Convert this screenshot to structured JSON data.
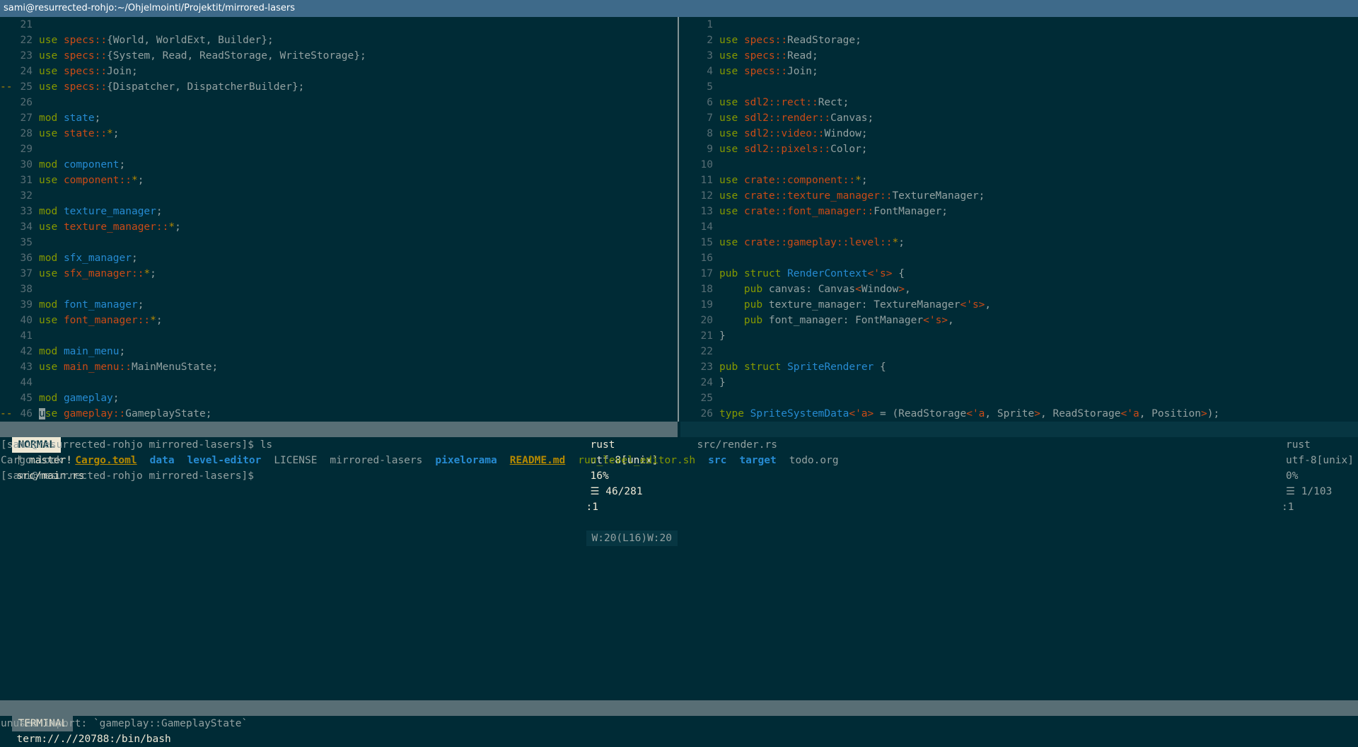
{
  "window": {
    "title": "sami@resurrected-rohjo:~/Ohjelmointi/Projektit/mirrored-lasers"
  },
  "left_pane": {
    "lines": [
      {
        "sign": "",
        "num": "21",
        "tokens": []
      },
      {
        "sign": "",
        "num": "22",
        "tokens": [
          {
            "t": "use",
            "c": "kw"
          },
          {
            "t": " "
          },
          {
            "t": "specs::",
            "c": "path"
          },
          {
            "t": "{World, WorldExt, Builder};"
          }
        ]
      },
      {
        "sign": "",
        "num": "23",
        "tokens": [
          {
            "t": "use",
            "c": "kw"
          },
          {
            "t": " "
          },
          {
            "t": "specs::",
            "c": "path"
          },
          {
            "t": "{System, Read, ReadStorage, WriteStorage};"
          }
        ]
      },
      {
        "sign": "",
        "num": "24",
        "tokens": [
          {
            "t": "use",
            "c": "kw"
          },
          {
            "t": " "
          },
          {
            "t": "specs::",
            "c": "path"
          },
          {
            "t": "Join;"
          }
        ]
      },
      {
        "sign": "--",
        "num": "25",
        "tokens": [
          {
            "t": "use",
            "c": "kw"
          },
          {
            "t": " "
          },
          {
            "t": "specs::",
            "c": "path"
          },
          {
            "t": "{Dispatcher, DispatcherBuilder};"
          }
        ]
      },
      {
        "sign": "",
        "num": "26",
        "tokens": []
      },
      {
        "sign": "",
        "num": "27",
        "tokens": [
          {
            "t": "mod",
            "c": "kw"
          },
          {
            "t": " "
          },
          {
            "t": "state",
            "c": "type"
          },
          {
            "t": ";"
          }
        ]
      },
      {
        "sign": "",
        "num": "28",
        "tokens": [
          {
            "t": "use",
            "c": "kw"
          },
          {
            "t": " "
          },
          {
            "t": "state::",
            "c": "path"
          },
          {
            "t": "*",
            "c": "op"
          },
          {
            "t": ";"
          }
        ]
      },
      {
        "sign": "",
        "num": "29",
        "tokens": []
      },
      {
        "sign": "",
        "num": "30",
        "tokens": [
          {
            "t": "mod",
            "c": "kw"
          },
          {
            "t": " "
          },
          {
            "t": "component",
            "c": "type"
          },
          {
            "t": ";"
          }
        ]
      },
      {
        "sign": "",
        "num": "31",
        "tokens": [
          {
            "t": "use",
            "c": "kw"
          },
          {
            "t": " "
          },
          {
            "t": "component::",
            "c": "path"
          },
          {
            "t": "*",
            "c": "op"
          },
          {
            "t": ";"
          }
        ]
      },
      {
        "sign": "",
        "num": "32",
        "tokens": []
      },
      {
        "sign": "",
        "num": "33",
        "tokens": [
          {
            "t": "mod",
            "c": "kw"
          },
          {
            "t": " "
          },
          {
            "t": "texture_manager",
            "c": "type"
          },
          {
            "t": ";"
          }
        ]
      },
      {
        "sign": "",
        "num": "34",
        "tokens": [
          {
            "t": "use",
            "c": "kw"
          },
          {
            "t": " "
          },
          {
            "t": "texture_manager::",
            "c": "path"
          },
          {
            "t": "*",
            "c": "op"
          },
          {
            "t": ";"
          }
        ]
      },
      {
        "sign": "",
        "num": "35",
        "tokens": []
      },
      {
        "sign": "",
        "num": "36",
        "tokens": [
          {
            "t": "mod",
            "c": "kw"
          },
          {
            "t": " "
          },
          {
            "t": "sfx_manager",
            "c": "type"
          },
          {
            "t": ";"
          }
        ]
      },
      {
        "sign": "",
        "num": "37",
        "tokens": [
          {
            "t": "use",
            "c": "kw"
          },
          {
            "t": " "
          },
          {
            "t": "sfx_manager::",
            "c": "path"
          },
          {
            "t": "*",
            "c": "op"
          },
          {
            "t": ";"
          }
        ]
      },
      {
        "sign": "",
        "num": "38",
        "tokens": []
      },
      {
        "sign": "",
        "num": "39",
        "tokens": [
          {
            "t": "mod",
            "c": "kw"
          },
          {
            "t": " "
          },
          {
            "t": "font_manager",
            "c": "type"
          },
          {
            "t": ";"
          }
        ]
      },
      {
        "sign": "",
        "num": "40",
        "tokens": [
          {
            "t": "use",
            "c": "kw"
          },
          {
            "t": " "
          },
          {
            "t": "font_manager::",
            "c": "path"
          },
          {
            "t": "*",
            "c": "op"
          },
          {
            "t": ";"
          }
        ]
      },
      {
        "sign": "",
        "num": "41",
        "tokens": []
      },
      {
        "sign": "",
        "num": "42",
        "tokens": [
          {
            "t": "mod",
            "c": "kw"
          },
          {
            "t": " "
          },
          {
            "t": "main_menu",
            "c": "type"
          },
          {
            "t": ";"
          }
        ]
      },
      {
        "sign": "",
        "num": "43",
        "tokens": [
          {
            "t": "use",
            "c": "kw"
          },
          {
            "t": " "
          },
          {
            "t": "main_menu::",
            "c": "path"
          },
          {
            "t": "MainMenuState;"
          }
        ]
      },
      {
        "sign": "",
        "num": "44",
        "tokens": []
      },
      {
        "sign": "",
        "num": "45",
        "tokens": [
          {
            "t": "mod",
            "c": "kw"
          },
          {
            "t": " "
          },
          {
            "t": "gameplay",
            "c": "type"
          },
          {
            "t": ";"
          }
        ]
      },
      {
        "sign": "--",
        "num": "46",
        "tokens": [
          {
            "t": "u",
            "c": "cursor"
          },
          {
            "t": "se",
            "c": "kw"
          },
          {
            "t": " "
          },
          {
            "t": "gameplay::",
            "c": "path"
          },
          {
            "t": "GameplayState;"
          }
        ]
      }
    ]
  },
  "right_pane": {
    "lines": [
      {
        "sign": "",
        "num": "1",
        "tokens": []
      },
      {
        "sign": "",
        "num": "2",
        "tokens": [
          {
            "t": "use",
            "c": "kw"
          },
          {
            "t": " "
          },
          {
            "t": "specs::",
            "c": "path"
          },
          {
            "t": "ReadStorage;"
          }
        ]
      },
      {
        "sign": "",
        "num": "3",
        "tokens": [
          {
            "t": "use",
            "c": "kw"
          },
          {
            "t": " "
          },
          {
            "t": "specs::",
            "c": "path"
          },
          {
            "t": "Read;"
          }
        ]
      },
      {
        "sign": "",
        "num": "4",
        "tokens": [
          {
            "t": "use",
            "c": "kw"
          },
          {
            "t": " "
          },
          {
            "t": "specs::",
            "c": "path"
          },
          {
            "t": "Join;"
          }
        ]
      },
      {
        "sign": "",
        "num": "5",
        "tokens": []
      },
      {
        "sign": "",
        "num": "6",
        "tokens": [
          {
            "t": "use",
            "c": "kw"
          },
          {
            "t": " "
          },
          {
            "t": "sdl2::rect::",
            "c": "path"
          },
          {
            "t": "Rect;"
          }
        ]
      },
      {
        "sign": "",
        "num": "7",
        "tokens": [
          {
            "t": "use",
            "c": "kw"
          },
          {
            "t": " "
          },
          {
            "t": "sdl2::render::",
            "c": "path"
          },
          {
            "t": "Canvas;"
          }
        ]
      },
      {
        "sign": "",
        "num": "8",
        "tokens": [
          {
            "t": "use",
            "c": "kw"
          },
          {
            "t": " "
          },
          {
            "t": "sdl2::video::",
            "c": "path"
          },
          {
            "t": "Window;"
          }
        ]
      },
      {
        "sign": "",
        "num": "9",
        "tokens": [
          {
            "t": "use",
            "c": "kw"
          },
          {
            "t": " "
          },
          {
            "t": "sdl2::pixels::",
            "c": "path"
          },
          {
            "t": "Color;"
          }
        ]
      },
      {
        "sign": "",
        "num": "10",
        "tokens": []
      },
      {
        "sign": "",
        "num": "11",
        "tokens": [
          {
            "t": "use",
            "c": "kw"
          },
          {
            "t": " "
          },
          {
            "t": "crate::component::",
            "c": "path"
          },
          {
            "t": "*",
            "c": "op"
          },
          {
            "t": ";"
          }
        ]
      },
      {
        "sign": "",
        "num": "12",
        "tokens": [
          {
            "t": "use",
            "c": "kw"
          },
          {
            "t": " "
          },
          {
            "t": "crate::texture_manager::",
            "c": "path"
          },
          {
            "t": "TextureManager;"
          }
        ]
      },
      {
        "sign": "",
        "num": "13",
        "tokens": [
          {
            "t": "use",
            "c": "kw"
          },
          {
            "t": " "
          },
          {
            "t": "crate::font_manager::",
            "c": "path"
          },
          {
            "t": "FontManager;"
          }
        ]
      },
      {
        "sign": "",
        "num": "14",
        "tokens": []
      },
      {
        "sign": "",
        "num": "15",
        "tokens": [
          {
            "t": "use",
            "c": "kw"
          },
          {
            "t": " "
          },
          {
            "t": "crate::gameplay::level::",
            "c": "path"
          },
          {
            "t": "*",
            "c": "op"
          },
          {
            "t": ";"
          }
        ]
      },
      {
        "sign": "",
        "num": "16",
        "tokens": []
      },
      {
        "sign": "",
        "num": "17",
        "tokens": [
          {
            "t": "pub",
            "c": "kw"
          },
          {
            "t": " "
          },
          {
            "t": "struct",
            "c": "kw"
          },
          {
            "t": " "
          },
          {
            "t": "RenderContext",
            "c": "type"
          },
          {
            "t": "<'s>",
            "c": "path"
          },
          {
            "t": " {"
          }
        ]
      },
      {
        "sign": "",
        "num": "18",
        "tokens": [
          {
            "t": "    "
          },
          {
            "t": "pub",
            "c": "kw"
          },
          {
            "t": " canvas: Canvas"
          },
          {
            "t": "<",
            "c": "path"
          },
          {
            "t": "Window"
          },
          {
            "t": ">",
            "c": "path"
          },
          {
            "t": ","
          }
        ]
      },
      {
        "sign": "",
        "num": "19",
        "tokens": [
          {
            "t": "    "
          },
          {
            "t": "pub",
            "c": "kw"
          },
          {
            "t": " texture_manager: TextureManager"
          },
          {
            "t": "<'s>",
            "c": "path"
          },
          {
            "t": ","
          }
        ]
      },
      {
        "sign": "",
        "num": "20",
        "tokens": [
          {
            "t": "    "
          },
          {
            "t": "pub",
            "c": "kw"
          },
          {
            "t": " font_manager: FontManager"
          },
          {
            "t": "<'s>",
            "c": "path"
          },
          {
            "t": ","
          }
        ]
      },
      {
        "sign": "",
        "num": "21",
        "tokens": [
          {
            "t": "}"
          }
        ]
      },
      {
        "sign": "",
        "num": "22",
        "tokens": []
      },
      {
        "sign": "",
        "num": "23",
        "tokens": [
          {
            "t": "pub",
            "c": "kw"
          },
          {
            "t": " "
          },
          {
            "t": "struct",
            "c": "kw"
          },
          {
            "t": " "
          },
          {
            "t": "SpriteRenderer",
            "c": "type"
          },
          {
            "t": " {"
          }
        ]
      },
      {
        "sign": "",
        "num": "24",
        "tokens": [
          {
            "t": "}"
          }
        ]
      },
      {
        "sign": "",
        "num": "25",
        "tokens": []
      },
      {
        "sign": "",
        "num": "26",
        "tokens": [
          {
            "t": "type",
            "c": "kw"
          },
          {
            "t": " "
          },
          {
            "t": "SpriteSystemData",
            "c": "type"
          },
          {
            "t": "<'a>",
            "c": "path"
          },
          {
            "t": " = (ReadStorage"
          },
          {
            "t": "<'a",
            "c": "path"
          },
          {
            "t": ", Sprite"
          },
          {
            "t": ">",
            "c": "path"
          },
          {
            "t": ", ReadStorage"
          },
          {
            "t": "<'a",
            "c": "path"
          },
          {
            "t": ", Position"
          },
          {
            "t": ">",
            "c": "path"
          },
          {
            "t": ");"
          }
        ]
      }
    ]
  },
  "status_left": {
    "mode": "NORMAL",
    "branch": "ᚠ master!",
    "file": "src/main.rs",
    "filetype": "rust",
    "encoding": "utf-8[unix]",
    "percent": "16%",
    "position": "☰ 46/281",
    "column": ":1",
    "warnings": "W:20(L16)W:20"
  },
  "status_right": {
    "file": "src/render.rs",
    "filetype": "rust",
    "encoding": "utf-8[unix]",
    "percent": "0%",
    "position": "☰ 1/103",
    "column": ":1"
  },
  "terminal": {
    "prompt1": "[sami@resurrected-rohjo mirrored-lasers]$ ls",
    "ls_items": [
      {
        "name": "Cargo.lock",
        "kind": "plain"
      },
      {
        "name": "Cargo.toml",
        "kind": "special"
      },
      {
        "name": "data",
        "kind": "dir"
      },
      {
        "name": "level-editor",
        "kind": "dir"
      },
      {
        "name": "LICENSE",
        "kind": "plain"
      },
      {
        "name": "mirrored-lasers",
        "kind": "plain"
      },
      {
        "name": "pixelorama",
        "kind": "dir"
      },
      {
        "name": "README.md",
        "kind": "special"
      },
      {
        "name": "run_level_editor.sh",
        "kind": "exec"
      },
      {
        "name": "src",
        "kind": "dir"
      },
      {
        "name": "target",
        "kind": "dir"
      },
      {
        "name": "todo.org",
        "kind": "plain"
      }
    ],
    "prompt2": "[sami@resurrected-rohjo mirrored-lasers]$"
  },
  "terminal_status": {
    "mode": "TERMINAL",
    "uri": "term://.//20788:/bin/bash"
  },
  "cmdline": {
    "message": "unused import: `gameplay::GameplayState`"
  },
  "colors": {
    "background": "#002b36",
    "keyword": "#859900",
    "path": "#cb4b16",
    "type": "#268bd2",
    "operator": "#b58900"
  }
}
